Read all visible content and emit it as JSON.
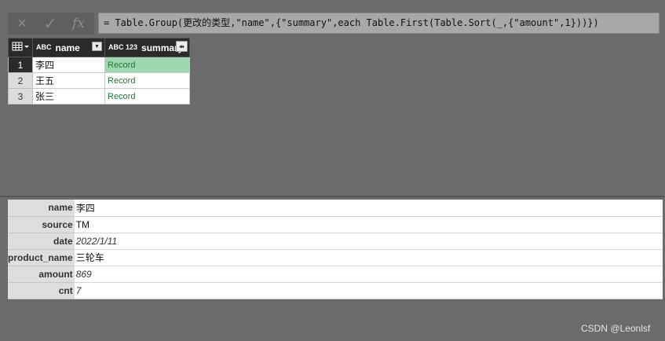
{
  "formula_bar": {
    "cancel_icon": "×",
    "confirm_icon": "✓",
    "fx_label": "fx",
    "formula": "= Table.Group(更改的类型,\"name\",{\"summary\",each Table.First(Table.Sort(_,{\"amount\",1}))})"
  },
  "grid": {
    "columns": [
      {
        "type_icon": "ABC",
        "label": "name"
      },
      {
        "type_icon": "ABC 123",
        "label": "summary"
      }
    ],
    "rows": [
      {
        "num": "1",
        "name": "李四",
        "summary": "Record"
      },
      {
        "num": "2",
        "name": "王五",
        "summary": "Record"
      },
      {
        "num": "3",
        "name": "张三",
        "summary": "Record"
      }
    ]
  },
  "preview": {
    "fields": [
      {
        "label": "name",
        "value": "李四"
      },
      {
        "label": "source",
        "value": "TM"
      },
      {
        "label": "date",
        "value": "2022/1/11"
      },
      {
        "label": "product_name",
        "value": "三轮车"
      },
      {
        "label": "amount",
        "value": "869"
      },
      {
        "label": "cnt",
        "value": "7"
      }
    ]
  },
  "watermark": "CSDN @Leonlsf"
}
